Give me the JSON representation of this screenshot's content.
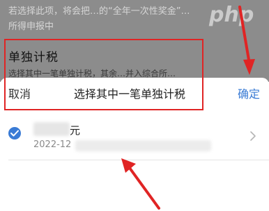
{
  "background": {
    "note_line1": "若选择此项，将会把…的“全年一次性奖金”…",
    "note_line2": "所得申报中",
    "heading": "单独计税",
    "desc": "选择其中一笔单独计税，其余…并入综合所…",
    "watermark": "php"
  },
  "sheet": {
    "cancel_label": "取消",
    "title": "选择其中一笔单独计税",
    "confirm_label": "确定"
  },
  "options": [
    {
      "amount_unit": "元",
      "date_prefix": "2022-12",
      "selected": true
    }
  ],
  "colors": {
    "accent": "#3a7bd5",
    "annotation": "#e02424",
    "overlay": "#8c8c8c"
  }
}
